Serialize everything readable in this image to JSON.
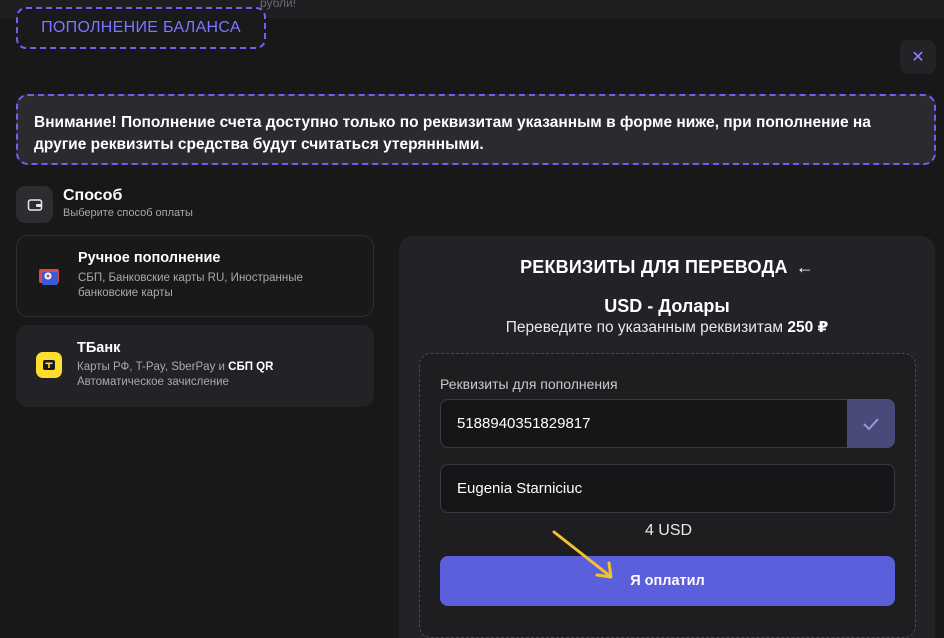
{
  "top_strip": {
    "text": "рубли!"
  },
  "header": {
    "title": "ПОПОЛНЕНИЕ БАЛАНСА",
    "close_icon": "close-icon"
  },
  "warning": {
    "text": "Внимание! Пополнение счета доступно только по реквизитам указанным в форме ниже, при пополнение на другие реквизиты средства будут считаться утерянными."
  },
  "method": {
    "icon": "wallet-icon",
    "title": "Способ",
    "subtitle": "Выберите способ оплаты"
  },
  "options": [
    {
      "title": "Ручное пополнение",
      "desc": "СБП, Банковские карты RU, Иностранные банковские карты",
      "icon": "bank-card-icon"
    },
    {
      "title": "ТБанк",
      "desc_prefix": "Карты РФ, T-Pay, SberPay и ",
      "desc_bold": "СБП QR",
      "desc_line2": "Автоматическое зачисление",
      "icon": "tbank-logo-icon"
    }
  ],
  "panel": {
    "heading": "РЕКВИЗИТЫ ДЛЯ ПЕРЕВОДА",
    "back_arrow": "←",
    "currency": "USD - Долары",
    "instruction": "Переведите по указанным реквизитам ",
    "instruction_amount": "250 ₽",
    "requisites_label": "Реквизиты для пополнения",
    "card_number": "5188940351829817",
    "holder_name": "Eugenia Starniciuc",
    "amount": "4 USD",
    "pay_button": "Я оплатил"
  },
  "colors": {
    "accent": "#5b5fdc",
    "dashed_border": "#6b63f2",
    "annotation_arrow": "#f2c12e"
  }
}
